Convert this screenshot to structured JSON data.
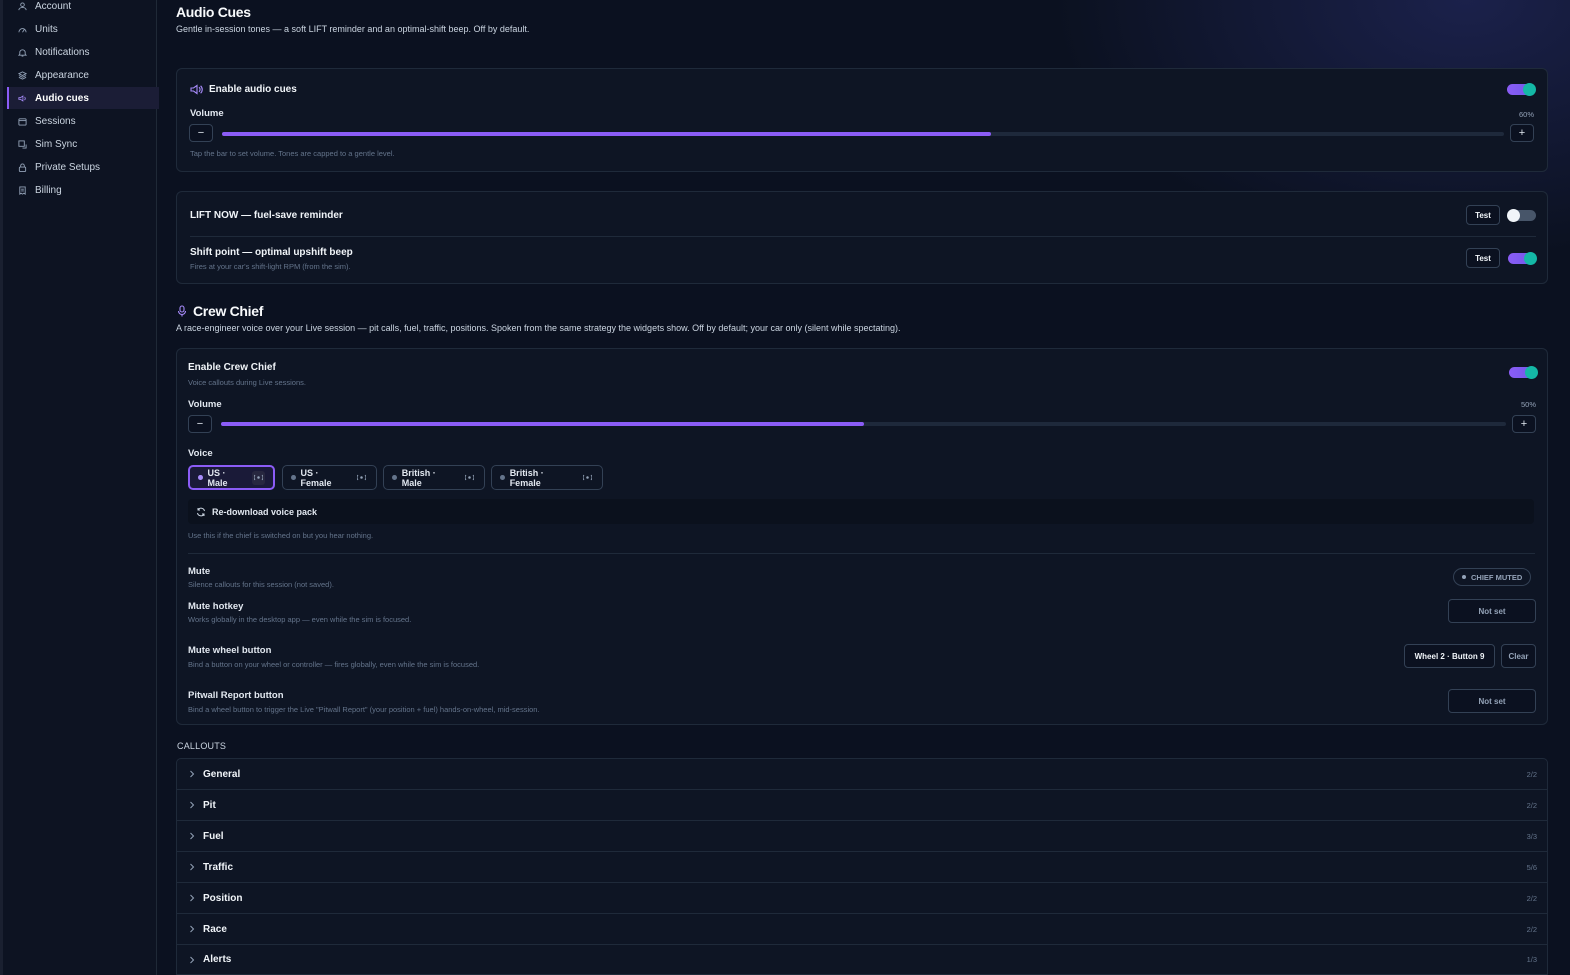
{
  "sidebar": {
    "items": [
      {
        "label": "Account",
        "icon": "user-icon"
      },
      {
        "label": "Units",
        "icon": "gauge-icon"
      },
      {
        "label": "Notifications",
        "icon": "bell-icon"
      },
      {
        "label": "Appearance",
        "icon": "layers-icon"
      },
      {
        "label": "Audio cues",
        "icon": "speaker-icon",
        "active": true
      },
      {
        "label": "Sessions",
        "icon": "calendar-icon"
      },
      {
        "label": "Sim Sync",
        "icon": "sync-icon"
      },
      {
        "label": "Private Setups",
        "icon": "lock-icon"
      },
      {
        "label": "Billing",
        "icon": "receipt-icon"
      }
    ]
  },
  "audio_cues": {
    "title": "Audio Cues",
    "description": "Gentle in-session tones — a soft LIFT reminder and an optimal-shift beep. Off by default.",
    "enable_label": "Enable audio cues",
    "enabled": true,
    "volume_label": "Volume",
    "volume_value": 60,
    "volume_text": "60%",
    "volume_hint": "Tap the bar to set volume. Tones are capped to a gentle level.",
    "minus": "−",
    "plus": "+",
    "lift_title": "LIFT NOW — fuel-save reminder",
    "lift_enabled": false,
    "shift_title": "Shift point — optimal upshift beep",
    "shift_sub": "Fires at your car's shift-light RPM (from the sim).",
    "shift_enabled": true,
    "test_label": "Test"
  },
  "crew_chief": {
    "title": "Crew Chief",
    "description": "A race-engineer voice over your Live session — pit calls, fuel, traffic, positions. Spoken from the same strategy the widgets show. Off by default; your car only (silent while spectating).",
    "enable_label": "Enable Crew Chief",
    "enable_sub": "Voice callouts during Live sessions.",
    "enabled": true,
    "volume_label": "Volume",
    "volume_value": 50,
    "volume_text": "50%",
    "minus": "−",
    "plus": "+",
    "voice_label": "Voice",
    "voices": [
      {
        "label": "US · Male",
        "selected": true
      },
      {
        "label": "US · Female",
        "selected": false
      },
      {
        "label": "British · Male",
        "selected": false
      },
      {
        "label": "British · Female",
        "selected": false
      }
    ],
    "redownload_label": "Re-download voice pack",
    "redownload_hint": "Use this if the chief is switched on but you hear nothing.",
    "mute_title": "Mute",
    "mute_sub": "Silence callouts for this session (not saved).",
    "mute_badge": "CHIEF MUTED",
    "hotkey_title": "Mute hotkey",
    "hotkey_sub": "Works globally in the desktop app — even while the sim is focused.",
    "hotkey_value": "Not set",
    "wheel_title": "Mute wheel button",
    "wheel_sub": "Bind a button on your wheel or controller — fires globally, even while the sim is focused.",
    "wheel_value": "Wheel 2 · Button 9",
    "clear_label": "Clear",
    "pitwall_title": "Pitwall Report button",
    "pitwall_sub": "Bind a wheel button to trigger the Live \"Pitwall Report\" (your position + fuel) hands-on-wheel, mid-session.",
    "pitwall_value": "Not set"
  },
  "callouts": {
    "heading": "CALLOUTS",
    "groups": [
      {
        "name": "General",
        "count": "2/2"
      },
      {
        "name": "Pit",
        "count": "2/2"
      },
      {
        "name": "Fuel",
        "count": "3/3"
      },
      {
        "name": "Traffic",
        "count": "5/6"
      },
      {
        "name": "Position",
        "count": "2/2"
      },
      {
        "name": "Race",
        "count": "2/2"
      },
      {
        "name": "Alerts",
        "count": "1/3"
      }
    ]
  },
  "colors": {
    "accent": "#8b5cf6",
    "toggle_knob_on": "#14b8a6",
    "background": "#0b1120"
  }
}
